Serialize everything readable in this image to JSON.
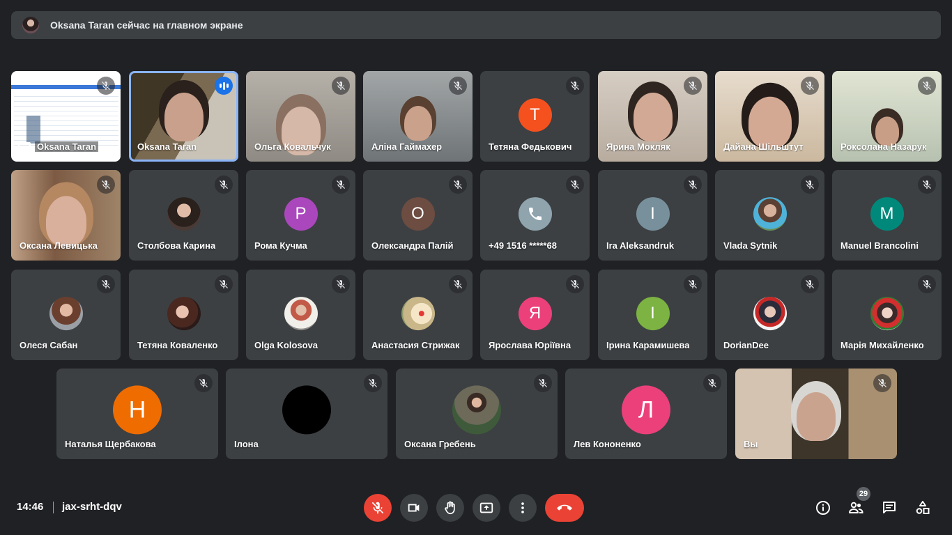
{
  "banner": {
    "text": "Oksana Taran сейчас на главном экране"
  },
  "tiles": [
    {
      "name": "Oksana Taran"
    },
    {
      "name": "Oksana Taran"
    },
    {
      "name": "Ольга Ковальчук"
    },
    {
      "name": "Аліна Гаймахер"
    },
    {
      "name": "Тетяна Федькович",
      "initial": "Т",
      "color": "#f4511e"
    },
    {
      "name": "Ярина Мокляк"
    },
    {
      "name": "Дайана Шільштут"
    },
    {
      "name": "Роксолана Назарук"
    },
    {
      "name": "Оксана Левицька"
    },
    {
      "name": "Столбова Карина"
    },
    {
      "name": "Рома Кучма",
      "initial": "P",
      "color": "#ab47bc"
    },
    {
      "name": "Олександра Палій"
    },
    {
      "name": "+49 1516 *****68"
    },
    {
      "name": "Ira Aleksandruk",
      "initial": "I",
      "color": "#78909c"
    },
    {
      "name": "Vlada Sytnik"
    },
    {
      "name": "Manuel Brancolini",
      "initial": "M",
      "color": "#00897b"
    },
    {
      "name": "Олеся Сабан"
    },
    {
      "name": "Тетяна Коваленко"
    },
    {
      "name": "Olga Kolosova"
    },
    {
      "name": "Анастасия Стрижак"
    },
    {
      "name": "Ярослава Юріївна",
      "initial": "Я",
      "color": "#ec407a"
    },
    {
      "name": "Ірина Карамишева",
      "initial": "І",
      "color": "#7cb342"
    },
    {
      "name": "DorianDee"
    },
    {
      "name": "Марія Михайленко"
    },
    {
      "name": "Наталья Щербакова",
      "initial": "Н",
      "color": "#ef6c00"
    },
    {
      "name": "Ілона"
    },
    {
      "name": "Оксана Гребень"
    },
    {
      "name": "Лев Кононенко",
      "initial": "Л",
      "color": "#ec407a"
    },
    {
      "name": "Вы"
    }
  ],
  "initials": {
    "t1": "Т",
    "t2": "P",
    "t3": "O",
    "t4": "I",
    "t5": "M",
    "t6": "Я",
    "t7": "І",
    "t8": "Н",
    "t9": "Л"
  },
  "footer": {
    "time": "14:46",
    "meeting_code": "jax-srht-dqv",
    "participant_count": "29"
  },
  "colors": {
    "background": "#202124",
    "tile": "#3c4043",
    "danger": "#ea4335",
    "speaking": "#1a73e8"
  }
}
